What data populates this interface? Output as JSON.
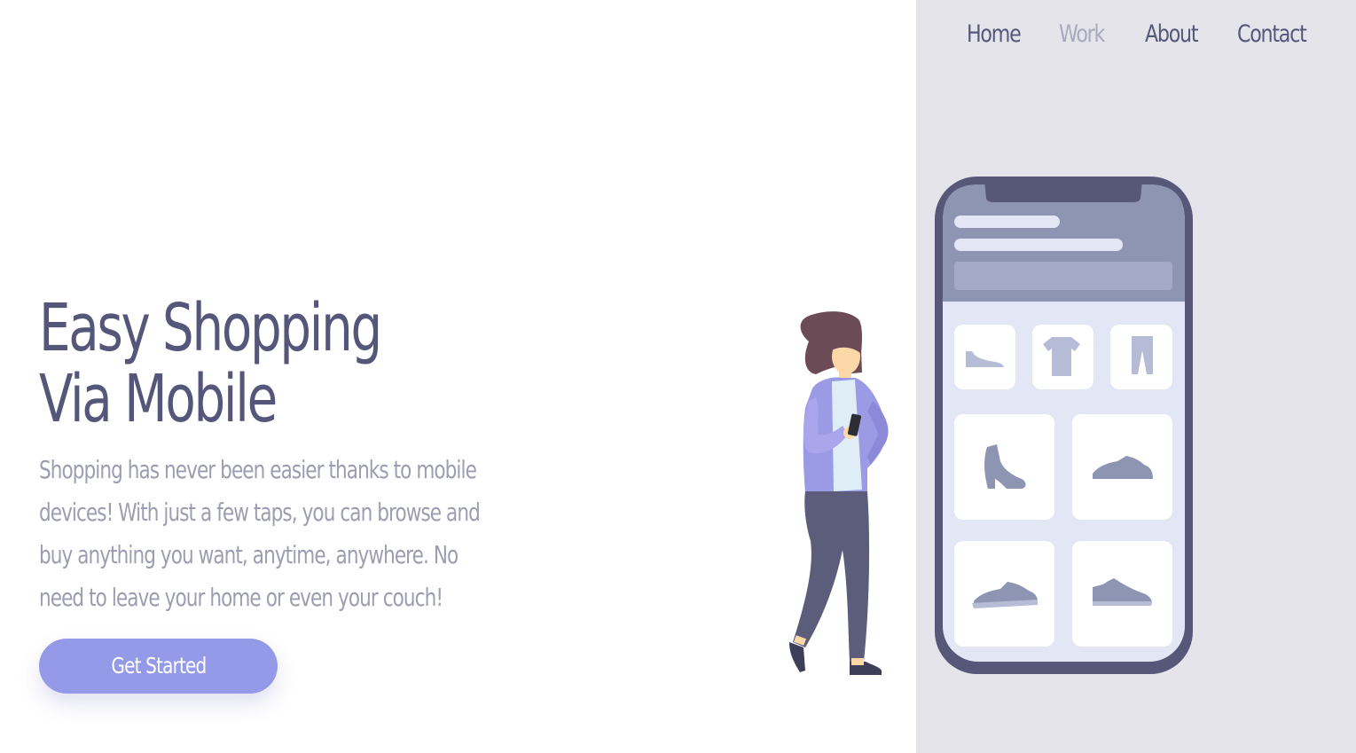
{
  "nav": {
    "items": [
      {
        "label": "Home",
        "active": false
      },
      {
        "label": "Work",
        "active": true
      },
      {
        "label": "About",
        "active": false
      },
      {
        "label": "Contact",
        "active": false
      }
    ]
  },
  "hero": {
    "title_line1": "Easy Shopping",
    "title_line2": "Via Mobile",
    "description": "Shopping has never been easier thanks to mobile devices! With just a few taps, you can browse and buy anything you want, anytime, anywhere. No need to leave your home or even your couch!",
    "cta_label": "Get Started"
  },
  "colors": {
    "heading": "#55577a",
    "body_text": "#9d9db2",
    "accent": "#9499e8",
    "side_panel": "#e5e4ea",
    "nav_active": "#a9a9bd"
  },
  "illustration": {
    "product_icons": [
      "flat-shoe-icon",
      "tshirt-icon",
      "pants-icon",
      "ankle-boot-icon",
      "sneaker-icon",
      "sneaker-icon",
      "sneaker-icon"
    ]
  }
}
